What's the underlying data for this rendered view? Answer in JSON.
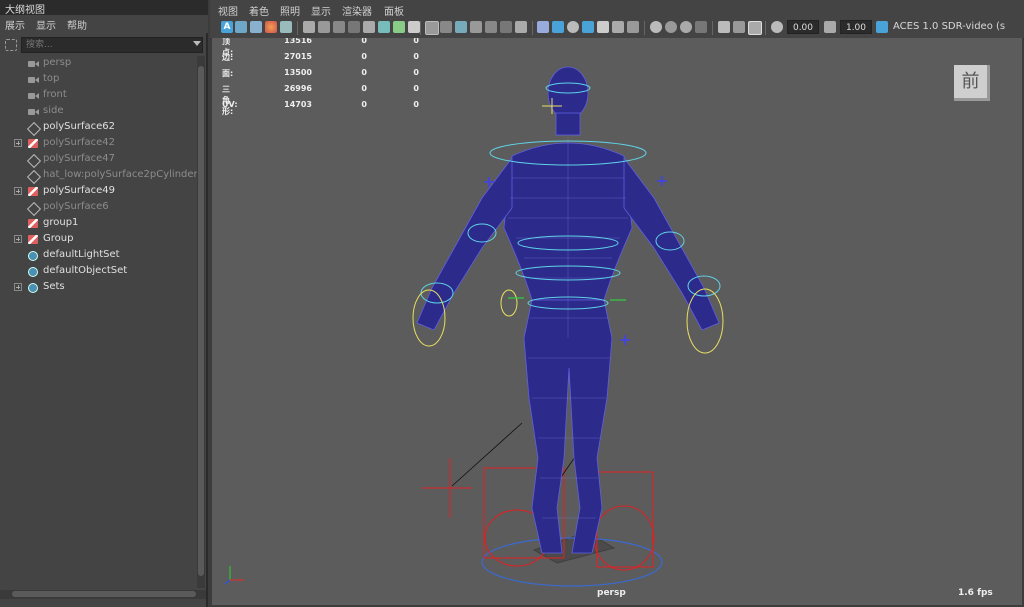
{
  "outliner": {
    "title": "大纲视图",
    "menu": [
      "展示",
      "显示",
      "帮助"
    ],
    "search_placeholder": "搜索...",
    "items": [
      {
        "label": "persp",
        "icon": "camera-icon",
        "expandable": false,
        "dim": true
      },
      {
        "label": "top",
        "icon": "camera-icon",
        "expandable": false,
        "dim": true
      },
      {
        "label": "front",
        "icon": "camera-icon",
        "expandable": false,
        "dim": true
      },
      {
        "label": "side",
        "icon": "camera-icon",
        "expandable": false,
        "dim": true
      },
      {
        "label": "polySurface62",
        "icon": "mesh-icon",
        "expandable": false,
        "dim": false
      },
      {
        "label": "polySurface42",
        "icon": "group-icon",
        "expandable": true,
        "dim": true
      },
      {
        "label": "polySurface47",
        "icon": "mesh-icon",
        "expandable": false,
        "dim": true
      },
      {
        "label": "hat_low:polySurface2pCylinder1",
        "icon": "mesh-icon",
        "expandable": false,
        "dim": true
      },
      {
        "label": "polySurface49",
        "icon": "group-icon",
        "expandable": true,
        "dim": false
      },
      {
        "label": "polySurface6",
        "icon": "mesh-icon",
        "expandable": false,
        "dim": true
      },
      {
        "label": "group1",
        "icon": "group-icon",
        "expandable": false,
        "dim": false
      },
      {
        "label": "Group",
        "icon": "group-icon",
        "expandable": true,
        "dim": false
      },
      {
        "label": "defaultLightSet",
        "icon": "set-icon",
        "expandable": false,
        "dim": false
      },
      {
        "label": "defaultObjectSet",
        "icon": "set-icon",
        "expandable": false,
        "dim": false
      },
      {
        "label": "Sets",
        "icon": "set-icon",
        "expandable": true,
        "dim": false
      }
    ]
  },
  "viewport_menu": [
    "视图",
    "着色",
    "照明",
    "显示",
    "渲染器",
    "面板"
  ],
  "toolbar": {
    "exposure": "0.00",
    "gamma": "1.00",
    "color_space": "ACES 1.0 SDR-video (s"
  },
  "hud": {
    "rows": [
      {
        "label": "顶点:",
        "values": [
          "13516",
          "0",
          "0"
        ]
      },
      {
        "label": "边:",
        "values": [
          "27015",
          "0",
          "0"
        ]
      },
      {
        "label": "面:",
        "values": [
          "13500",
          "0",
          "0"
        ]
      },
      {
        "label": "三角形:",
        "values": [
          "26996",
          "0",
          "0"
        ]
      },
      {
        "label": "UV:",
        "values": [
          "14703",
          "0",
          "0"
        ]
      }
    ]
  },
  "viewcube_label": "前",
  "camera_name": "persp",
  "fps": "1.6 fps",
  "colors": {
    "mesh": "#2c2a8a",
    "mesh_wire": "#5b5bd6",
    "ctrl_cyan": "#5fd3e8",
    "ctrl_yellow": "#e8e060",
    "ctrl_red": "#e02020",
    "viewport_bg": "#5c5c5c"
  }
}
